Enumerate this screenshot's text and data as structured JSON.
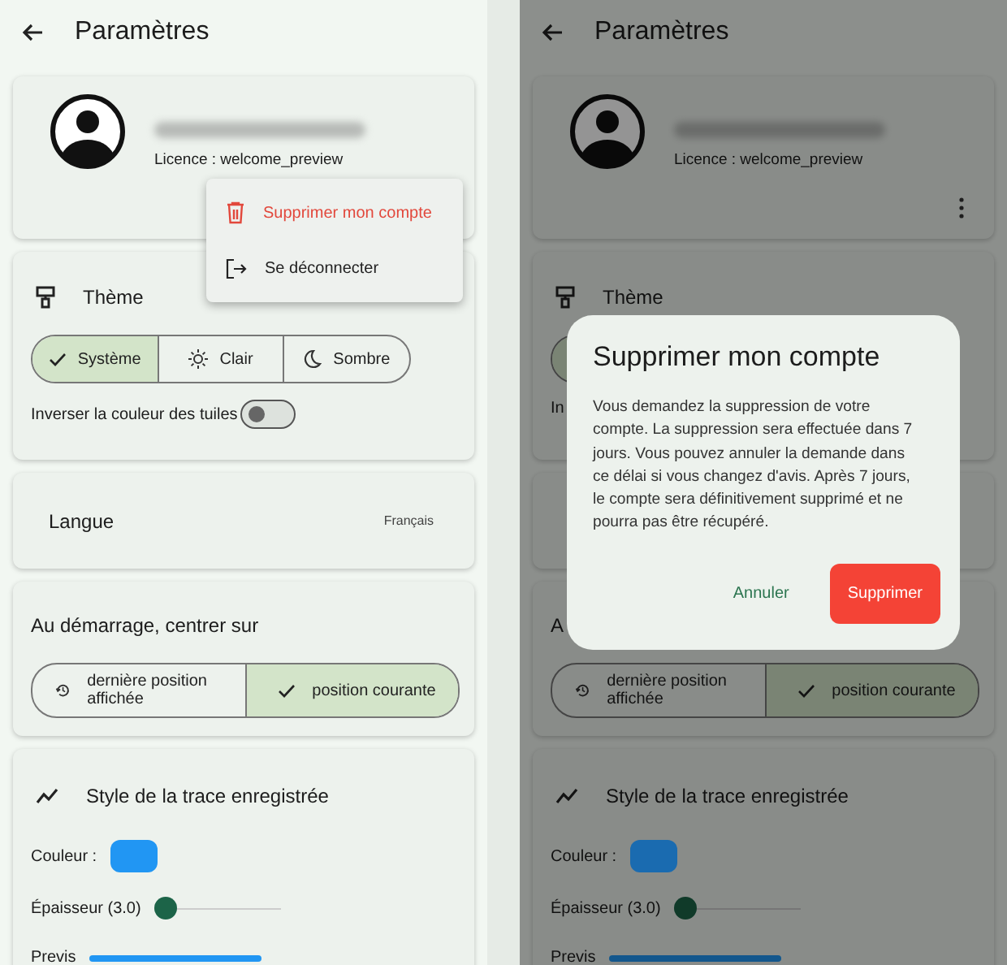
{
  "screens": [
    {
      "header": {
        "title": "Paramètres"
      },
      "account": {
        "license": "Licence : welcome_preview"
      },
      "theme": {
        "title": "Thème",
        "options": [
          {
            "label": "Système",
            "selected": true
          },
          {
            "label": "Clair",
            "selected": false
          },
          {
            "label": "Sombre",
            "selected": false
          }
        ],
        "invert_label": "Inverser la couleur des tuiles",
        "invert_on": false
      },
      "language": {
        "label": "Langue",
        "value": "Français"
      },
      "startup": {
        "title": "Au démarrage, centrer sur",
        "options": [
          {
            "label": "dernière position affichée",
            "selected": false
          },
          {
            "label": "position courante",
            "selected": true
          }
        ]
      },
      "trace": {
        "title": "Style de la trace enregistrée",
        "color_label": "Couleur :",
        "color": "#2196f3",
        "width_label": "Épaisseur (3.0)",
        "width_slider": {
          "level": 0
        },
        "preview_label": "Previs"
      },
      "menu": {
        "items": [
          {
            "label": "Supprimer mon compte",
            "kind": "danger"
          },
          {
            "label": "Se déconnecter",
            "kind": "normal"
          }
        ]
      }
    },
    {
      "header": {
        "title": "Paramètres"
      },
      "account": {
        "license": "Licence : welcome_preview"
      },
      "theme": {
        "title": "Thème",
        "options": [
          {
            "selected": true
          }
        ],
        "invert_label": "In"
      },
      "startup": {
        "title": "A",
        "options": [
          {
            "label": "dernière position affichée",
            "selected": false
          },
          {
            "label": "position courante",
            "selected": true
          }
        ]
      },
      "trace": {
        "title": "Style de la trace enregistrée",
        "color_label": "Couleur :",
        "color": "#1a6bb0",
        "width_label": "Épaisseur (3.0)",
        "width_slider": {
          "level": 0
        },
        "preview_label": "Previs"
      },
      "dialog": {
        "title": "Supprimer mon compte",
        "body": "Vous demandez la suppression de votre compte. La suppression sera effectuée dans 7 jours. Vous pouvez annuler la demande dans ce délai si vous changez d'avis. Après 7 jours, le compte sera définitivement supprimé et ne pourra pas être récupéré.",
        "actions": [
          {
            "label": "Annuler",
            "kind": "text"
          },
          {
            "label": "Supprimer",
            "kind": "danger"
          }
        ]
      }
    }
  ]
}
